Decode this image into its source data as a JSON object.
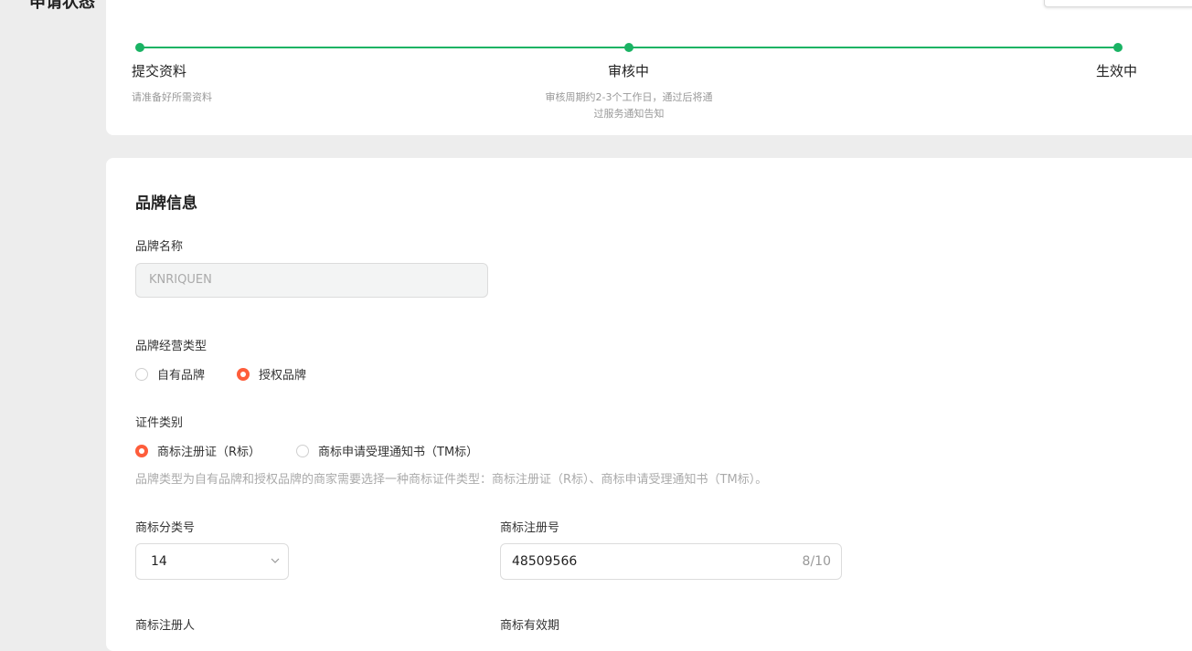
{
  "status": {
    "title": "申请状态",
    "steps": [
      {
        "label": "提交资料",
        "desc": "请准备好所需资料"
      },
      {
        "label": "审核中",
        "desc_line1": "审核周期约2-3个工作日，通过后将通",
        "desc_line2": "过服务通知告知"
      },
      {
        "label": "生效中"
      }
    ],
    "accent_color": "#1ab364"
  },
  "brand": {
    "title": "品牌信息",
    "name_label": "品牌名称",
    "name_value": "KNRIQUEN",
    "type_label": "品牌经营类型",
    "type_options": [
      {
        "label": "自有品牌",
        "checked": false
      },
      {
        "label": "授权品牌",
        "checked": true
      }
    ],
    "cert_label": "证件类别",
    "cert_options": [
      {
        "label": "商标注册证（R标）",
        "checked": true
      },
      {
        "label": "商标申请受理通知书（TM标）",
        "checked": false
      }
    ],
    "cert_hint": "品牌类型为自有品牌和授权品牌的商家需要选择一种商标证件类型：商标注册证（R标）、商标申请受理通知书（TM标）。",
    "class_label": "商标分类号",
    "class_value": "14",
    "reg_no_label": "商标注册号",
    "reg_no_value": "48509566",
    "reg_no_counter": "8/10",
    "registrant_label": "商标注册人",
    "validity_label": "商标有效期",
    "radio_color": "#fe5d3b"
  }
}
